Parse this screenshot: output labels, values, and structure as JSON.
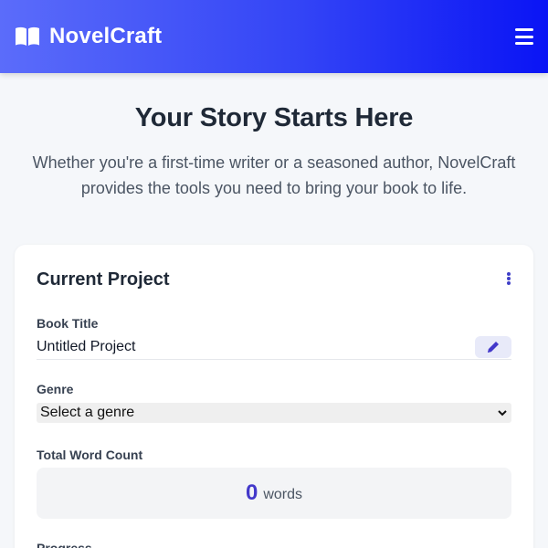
{
  "app": {
    "name": "NovelCraft",
    "icon": "book-open-icon",
    "accent_colors": {
      "header_start": "#5b6cfa",
      "header_end": "#0a14f5",
      "primary": "#4338ca"
    }
  },
  "header": {
    "menu_icon": "hamburger-menu-icon"
  },
  "hero": {
    "title": "Your Story Starts Here",
    "subtitle": "Whether you're a first-time writer or a seasoned author, NovelCraft provides the tools you need to bring your book to life."
  },
  "project_card": {
    "title": "Current Project",
    "more_icon": "more-vertical-icon",
    "book_title": {
      "label": "Book Title",
      "value": "Untitled Project",
      "edit_icon": "pencil-icon"
    },
    "genre": {
      "label": "Genre",
      "selected": "Select a genre"
    },
    "word_count": {
      "label": "Total Word Count",
      "value": "0",
      "unit": "words"
    },
    "progress": {
      "label": "Progress"
    }
  }
}
